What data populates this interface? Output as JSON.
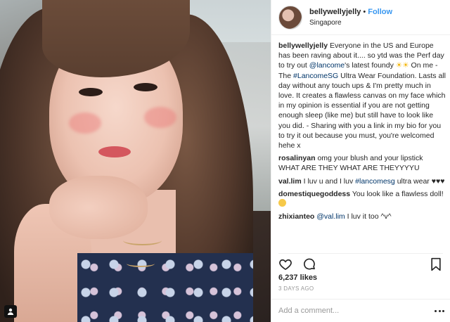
{
  "post": {
    "username": "bellywellyjelly",
    "separator": "•",
    "follow_label": "Follow",
    "location": "Singapore"
  },
  "caption": {
    "username": "bellywellyjelly",
    "text_1": " Everyone in the US and Europe has been raving about it.... so ytd was the Perf day to try out ",
    "mention": "@lancome",
    "text_2": "'s latest foundy ",
    "emoji": "☀☀",
    "text_3": " On me - The ",
    "hashtag": "#LancomeSG",
    "text_4": " Ultra Wear Foundation. Lasts all day without any touch ups & I'm pretty much in love. It creates a flawless canvas on my face which in my opinion is essential if you are not getting enough sleep (like me) but still have to look like you did. - Sharing with you a link in my bio for you to try it out because you must, you're welcomed hehe x"
  },
  "comments": [
    {
      "username": "rosalinyan",
      "text": " omg your blush and your lipstick WHAT ARE THEY WHAT ARE THEYYYYU"
    },
    {
      "username": "val.lim",
      "text_1": " I luv u and I luv ",
      "hashtag": "#lancomesg",
      "text_2": " ultra wear ",
      "emoji": "♥♥♥"
    },
    {
      "username": "domestiquegoddess",
      "text": " You look like a flawless doll! "
    },
    {
      "username": "zhixianteo",
      "mention": "@val.lim",
      "text": " I luv it too ^v^"
    }
  ],
  "actions": {
    "heart_icon": "heart-icon",
    "comment_icon": "comment-icon",
    "bookmark_icon": "bookmark-icon"
  },
  "likes": "6,237 likes",
  "time_ago": "3 DAYS AGO",
  "add_comment_placeholder": "Add a comment...",
  "colors": {
    "link": "#003569",
    "follow": "#3897f0",
    "text": "#262626",
    "muted": "#999999"
  }
}
